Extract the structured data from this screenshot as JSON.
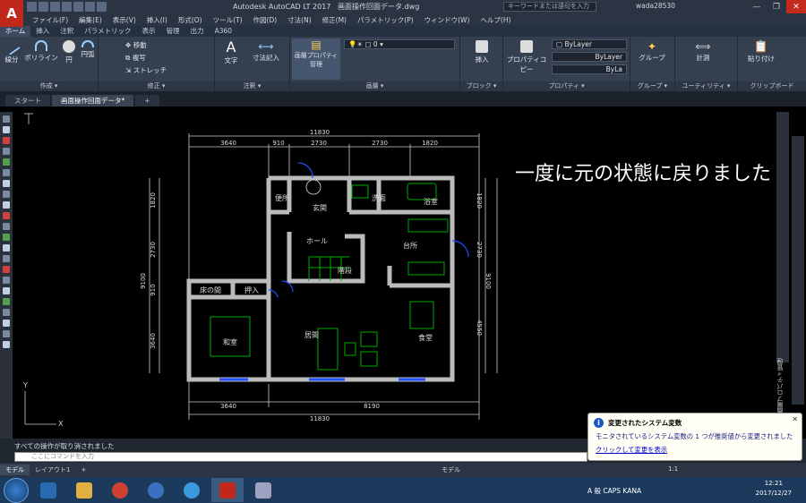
{
  "app": {
    "logo": "A",
    "logo_sub": "LT",
    "title": "Autodesk AutoCAD LT 2017",
    "file": "画面操作回面データ.dwg",
    "search_placeholder": "キーワードまたは語句を入力",
    "user": "wada28530"
  },
  "menu": [
    "ファイル(F)",
    "編集(E)",
    "表示(V)",
    "挿入(I)",
    "形式(O)",
    "ツール(T)",
    "作図(D)",
    "寸法(N)",
    "修正(M)",
    "パラメトリック(P)",
    "ウィンドウ(W)",
    "ヘルプ(H)"
  ],
  "ribbon_tabs": [
    "ホーム",
    "挿入",
    "注釈",
    "パラメトリック",
    "表示",
    "管理",
    "出力",
    "A360"
  ],
  "ribbon": {
    "draw": {
      "label": "作成 ▾",
      "line": "線分",
      "polyline": "ポリライン",
      "circle": "円",
      "arc": "円弧"
    },
    "modify": {
      "label": "修正 ▾",
      "move": "移動",
      "copy": "複写",
      "stretch": "ストレッチ"
    },
    "annotation": {
      "label": "注釈 ▾",
      "text": "文字",
      "dimension": "寸法記入"
    },
    "layers": {
      "label": "画層 ▾",
      "properties": "画層プロパティ管理",
      "current_layer": "0"
    },
    "block": {
      "label": "ブロック ▾",
      "insert": "挿入"
    },
    "properties": {
      "label": "プロパティ ▾",
      "match": "プロパティコピー",
      "color": "ByLayer",
      "linetype": "ByLayer",
      "lineweight": "ByLa"
    },
    "groups": {
      "label": "グループ ▾",
      "group": "グループ"
    },
    "utilities": {
      "label": "ユーティリティ ▾",
      "measure": "計測"
    },
    "clipboard": {
      "label": "クリップボード",
      "paste": "貼り付け"
    }
  },
  "doc_tabs": [
    "スタート",
    "画面操作回面データ*"
  ],
  "drawing": {
    "annotation": "一度に元の状態に戻りました",
    "top_total": "11830",
    "top_dims": [
      "3640",
      "910",
      "2730",
      "2730",
      "1820"
    ],
    "bottom_dims": [
      "3640",
      "8190"
    ],
    "bottom_total": "11830",
    "left_total": "9100",
    "left_dims": [
      "1820",
      "2730",
      "910",
      "3640"
    ],
    "right_total": "9100",
    "right_dims": [
      "1820",
      "2730",
      "4550"
    ],
    "rooms": [
      "便所",
      "玄関",
      "洗面",
      "浴室",
      "ホール",
      "台所",
      "階段",
      "床の間",
      "押入",
      "和室",
      "居間",
      "食堂"
    ],
    "ucs_x": "X",
    "ucs_y": "Y"
  },
  "palette_label": "画層プロパティ管理",
  "command": {
    "history": "すべての操作が取り消されました",
    "placeholder": "ここにコマンドを入力"
  },
  "layout_tabs": [
    "モデル",
    "レイアウト1",
    "+"
  ],
  "status": {
    "model": "モデル",
    "scale": "1:1"
  },
  "notification": {
    "title": "変更されたシステム変数",
    "body": "モニタされているシステム変数の 1 つが推奨値から変更されました",
    "link": "クリックして変更を表示"
  },
  "taskbar": {
    "tray": "A 般 CAPS KANA",
    "time": "12:21",
    "date": "2017/12/27"
  }
}
